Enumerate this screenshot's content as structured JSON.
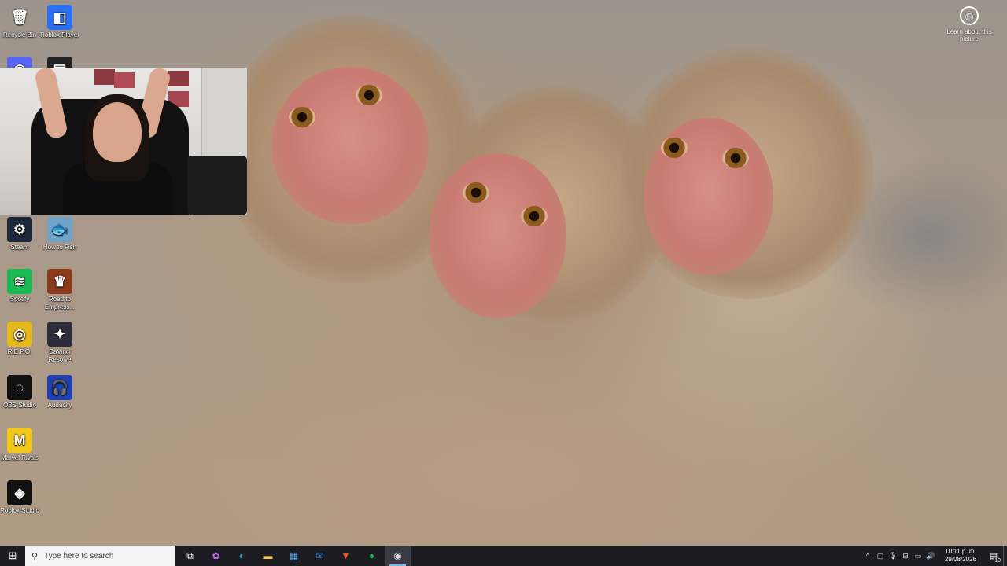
{
  "desktop_icons": [
    {
      "label": "Recycle Bin",
      "icon": "recycle-bin-icon",
      "glyph": "🗑",
      "bg": "transparent"
    },
    {
      "label": "Roblox Player",
      "icon": "roblox-icon",
      "glyph": "◧",
      "bg": "#2a6ff5"
    },
    {
      "label": "",
      "icon": "discord-icon",
      "glyph": "◉",
      "bg": "#5865f2"
    },
    {
      "label": "",
      "icon": "epic-games-icon",
      "glyph": "▤",
      "bg": "#222"
    },
    {
      "label": "Steam",
      "icon": "steam-icon",
      "glyph": "⚙",
      "bg": "#1b2838"
    },
    {
      "label": "How to Fish",
      "icon": "how-to-fish-icon",
      "glyph": "🐟",
      "bg": "#6fa3c9"
    },
    {
      "label": "Spotify",
      "icon": "spotify-icon",
      "glyph": "≋",
      "bg": "#1db954"
    },
    {
      "label": "Road to Empress...",
      "icon": "road-to-empress-icon",
      "glyph": "♛",
      "bg": "#8a3b1c"
    },
    {
      "label": "R.E.P.O.",
      "icon": "repo-icon",
      "glyph": "◎",
      "bg": "#e7b81b"
    },
    {
      "label": "DaVinci Resolve",
      "icon": "davinci-resolve-icon",
      "glyph": "✦",
      "bg": "#2c2c3a"
    },
    {
      "label": "OBS Studio",
      "icon": "obs-studio-icon",
      "glyph": "◌",
      "bg": "#111"
    },
    {
      "label": "Audacity",
      "icon": "audacity-icon",
      "glyph": "🎧",
      "bg": "#1f3fb3"
    },
    {
      "label": "Marvel Rivals",
      "icon": "marvel-rivals-icon",
      "glyph": "M",
      "bg": "#f3c61b"
    },
    {
      "label": "Roblox Studio",
      "icon": "roblox-studio-icon",
      "glyph": "◈",
      "bg": "#111"
    }
  ],
  "learn_about": {
    "label": "Learn about this picture",
    "icon": "camera-icon",
    "glyph": "◍"
  },
  "taskbar": {
    "start_glyph": "⊞",
    "search_placeholder": "Type here to search",
    "search_glyph": "⚲",
    "apps": [
      {
        "name": "task-view-icon",
        "glyph": "⧉",
        "color": "#ffffff",
        "active": false
      },
      {
        "name": "copilot-icon",
        "glyph": "✿",
        "color": "#c46bf0",
        "active": false
      },
      {
        "name": "edge-icon",
        "glyph": "◐",
        "color": "#2fb3e6",
        "active": false
      },
      {
        "name": "file-explorer-icon",
        "glyph": "▬",
        "color": "#f2c94c",
        "active": false
      },
      {
        "name": "microsoft-store-icon",
        "glyph": "▦",
        "color": "#5fb4f0",
        "active": false
      },
      {
        "name": "outlook-icon",
        "glyph": "✉",
        "color": "#2a7bd8",
        "active": false
      },
      {
        "name": "brave-icon",
        "glyph": "▼",
        "color": "#fb542b",
        "active": false
      },
      {
        "name": "spotify-taskbar-icon",
        "glyph": "●",
        "color": "#1db954",
        "active": false
      },
      {
        "name": "obs-taskbar-icon",
        "glyph": "◉",
        "color": "#dddddd",
        "active": true
      }
    ],
    "tray": [
      {
        "name": "show-hidden-icons-icon",
        "glyph": "^"
      },
      {
        "name": "meet-now-icon",
        "glyph": "▢"
      },
      {
        "name": "microphone-icon",
        "glyph": "🎙"
      },
      {
        "name": "usb-icon",
        "glyph": "⊟"
      },
      {
        "name": "network-icon",
        "glyph": "▭"
      },
      {
        "name": "volume-icon",
        "glyph": "🔊"
      }
    ],
    "time": "10:11 p. m.",
    "date": "29/08/2026",
    "notification_glyph": "▤",
    "notification_count": "10"
  },
  "colors": {
    "taskbar_bg": "#1c1c22",
    "accent": "#76b9ed"
  }
}
